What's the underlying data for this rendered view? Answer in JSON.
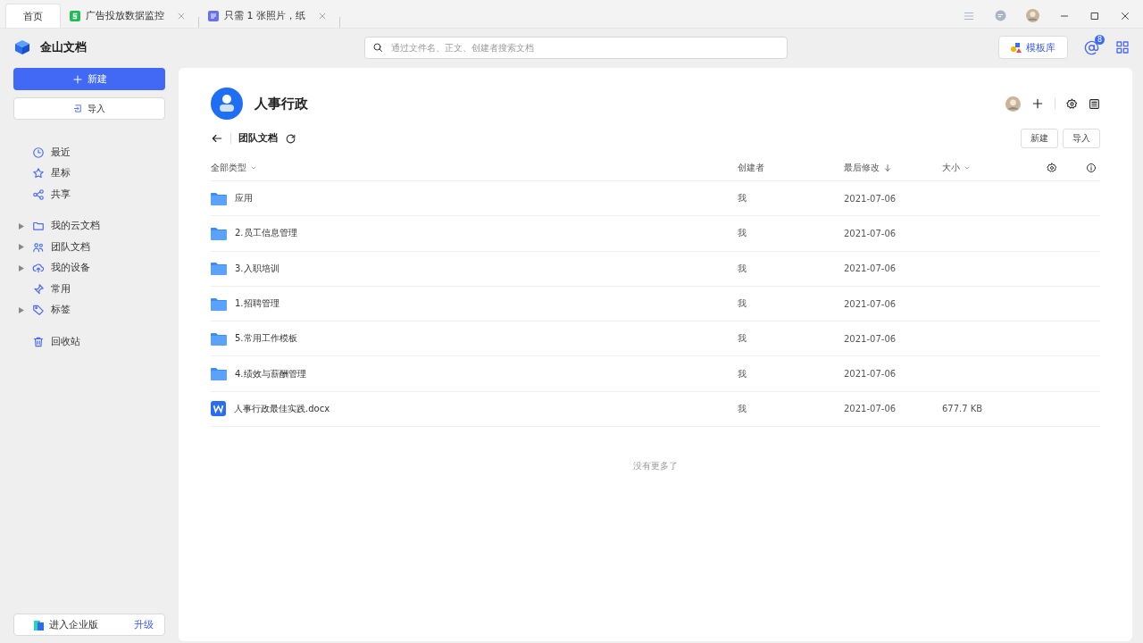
{
  "tabs": [
    {
      "label": "首页",
      "kind": "home",
      "selected": true
    },
    {
      "label": "广告投放数据监控",
      "kind": "sheet",
      "selected": false
    },
    {
      "label": "只需 1 张照片，纸",
      "kind": "doc",
      "selected": false
    }
  ],
  "app": {
    "name": "金山文档"
  },
  "search": {
    "placeholder": "通过文件名、正文、创建者搜索文档"
  },
  "template_button": "模板库",
  "mention_badge": "8",
  "sidebar": {
    "new_button": "新建",
    "import_button": "导入",
    "groups": [
      [
        {
          "label": "最近",
          "kind": "clock",
          "collapsible": false
        },
        {
          "label": "星标",
          "kind": "star",
          "collapsible": false
        },
        {
          "label": "共享",
          "kind": "share",
          "collapsible": false
        }
      ],
      [
        {
          "label": "我的云文档",
          "kind": "folder",
          "collapsible": true
        },
        {
          "label": "团队文档",
          "kind": "team",
          "collapsible": true
        },
        {
          "label": "我的设备",
          "kind": "cloud",
          "collapsible": true
        },
        {
          "label": "常用",
          "kind": "pin",
          "collapsible": false
        },
        {
          "label": "标签",
          "kind": "tag",
          "collapsible": true
        }
      ],
      [
        {
          "label": "回收站",
          "kind": "trash",
          "collapsible": false
        }
      ]
    ],
    "enterprise": {
      "label": "进入企业版",
      "link": "升级"
    }
  },
  "team": {
    "name": "人事行政"
  },
  "breadcrumb": "团队文档",
  "actions": [
    "新建",
    "导入"
  ],
  "table": {
    "columns": [
      {
        "label": "全部类型",
        "kind": "dropdown"
      },
      {
        "label": "创建者",
        "kind": "plain"
      },
      {
        "label": "最后修改",
        "kind": "sort"
      },
      {
        "label": "大小",
        "kind": "dropdown"
      }
    ],
    "rows": [
      {
        "kind": "folder",
        "name": "应用",
        "creator": "我",
        "modified": "2021-07-06"
      },
      {
        "kind": "folder",
        "name": "2.员工信息管理",
        "creator": "我",
        "modified": "2021-07-06"
      },
      {
        "kind": "folder",
        "name": "3.入职培训",
        "creator": "我",
        "modified": "2021-07-06"
      },
      {
        "kind": "folder",
        "name": "1.招聘管理",
        "creator": "我",
        "modified": "2021-07-06"
      },
      {
        "kind": "folder",
        "name": "5.常用工作模板",
        "creator": "我",
        "modified": "2021-07-06"
      },
      {
        "kind": "folder",
        "name": "4.绩效与薪酬管理",
        "creator": "我",
        "modified": "2021-07-06"
      },
      {
        "kind": "doc",
        "name": "人事行政最佳实践.docx",
        "creator": "我",
        "modified": "2021-07-06",
        "size": "677.7 KB"
      }
    ]
  },
  "end_note": "没有更多了"
}
